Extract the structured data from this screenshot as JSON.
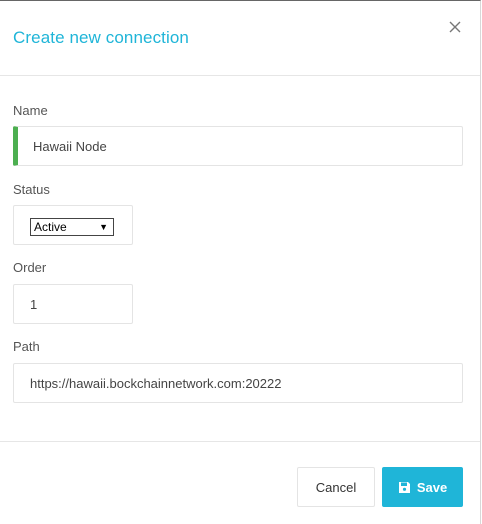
{
  "dialog": {
    "title": "Create new connection",
    "close_icon": "close-icon"
  },
  "form": {
    "name_label": "Name",
    "name_value": "Hawaii Node",
    "status_label": "Status",
    "status_value": "Active",
    "order_label": "Order",
    "order_value": "1",
    "path_label": "Path",
    "path_value": "https://hawaii.bockchainnetwork.com:20222"
  },
  "footer": {
    "cancel_label": "Cancel",
    "save_label": "Save",
    "save_icon": "floppy-disk-icon"
  },
  "colors": {
    "accent": "#1fb5d8",
    "valid_indicator": "#4caf50"
  }
}
